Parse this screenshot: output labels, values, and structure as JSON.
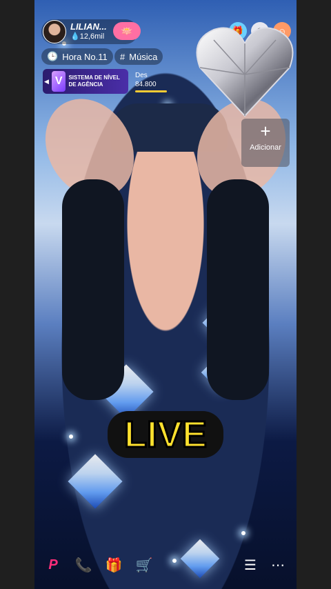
{
  "host": {
    "name": "LILIAN...",
    "likes": "12,6mil",
    "follow_icon": "lotus-icon"
  },
  "top_icons": [
    "gift-box-icon",
    "badge-icon",
    "avatar-icon"
  ],
  "pills": {
    "hour": "Hora No.11",
    "category": "Música"
  },
  "banner": {
    "text": "SISTEMA DE NÍVEL DE AGÊNCIA"
  },
  "challenge": {
    "label": "Des",
    "value": "84.800"
  },
  "add_button": {
    "label": "Adicionar",
    "symbol": "+"
  },
  "overlay": {
    "live_text": "LIVE"
  },
  "bottom_bar": {
    "left": [
      "p-icon",
      "phone-icon",
      "gift-icon",
      "shop-cart-icon"
    ],
    "right": [
      "menu-icon",
      "more-icon"
    ]
  },
  "colors": {
    "accent_pink": "#ff6fa3",
    "live_yellow": "#ffe12e",
    "banner_purple": "#4a2ea8"
  }
}
